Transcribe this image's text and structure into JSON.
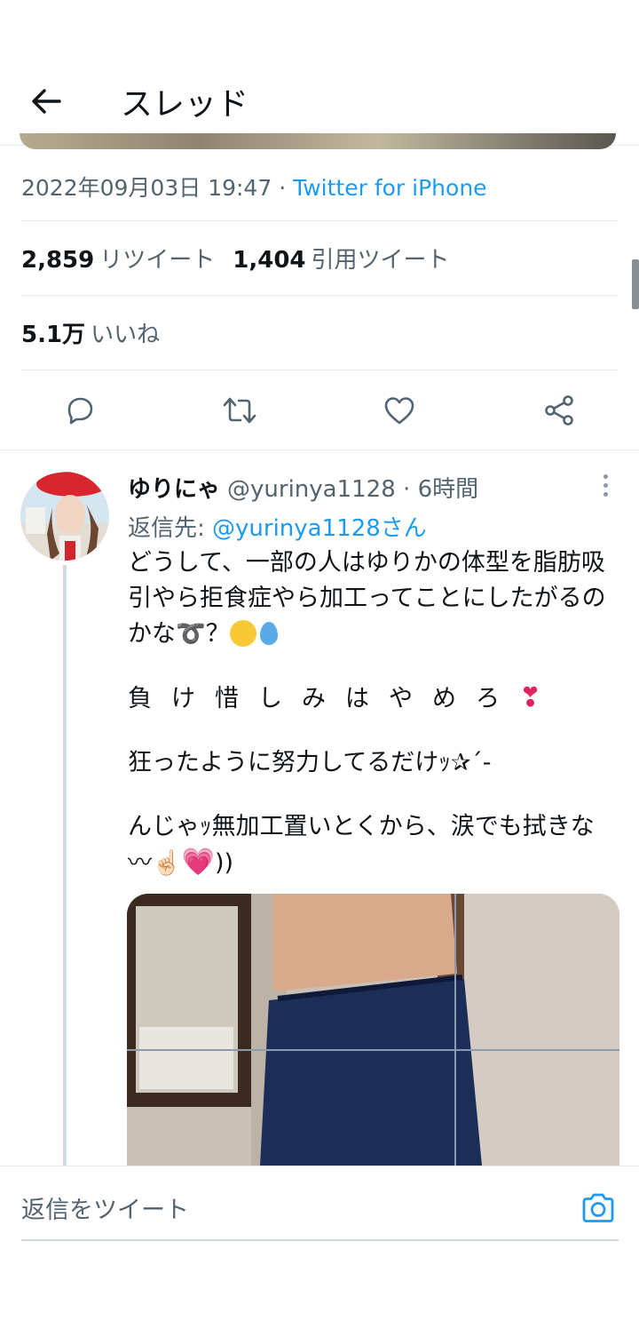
{
  "header": {
    "title": "スレッド",
    "back_icon": "arrow-left-icon"
  },
  "main_tweet": {
    "timestamp": "2022年09月03日 19:47",
    "separator": " · ",
    "client": "Twitter for iPhone",
    "retweets_count": "2,859",
    "retweets_label": "リツイート",
    "quotes_count": "1,404",
    "quotes_label": "引用ツイート",
    "likes_count": "5.1万",
    "likes_label": "いいね",
    "actions": [
      "reply-icon",
      "retweet-icon",
      "like-icon",
      "share-icon"
    ]
  },
  "reply": {
    "name": "ゆりにゃ",
    "handle": "@yurinya1128",
    "time": "6時間",
    "replying_to_label": "返信先: ",
    "replying_to_mention": "@yurinya1128さん",
    "text_line1": "どうして、一部の人はゆりかの体型を脂肪吸引やら拒食症やら加工ってことにしたがるのかな➰？",
    "text_line2": "負けしみはやめろ",
    "text_line2_full": "負け惜しみはやめろ",
    "text_line3": "狂ったように努力してるだけｯ✰´-",
    "text_line4": "んじゃｯ無加工置いとくから、涙でも拭きな〰☝🏻",
    "text_line4_tail": "))"
  },
  "composer": {
    "placeholder": "返信をツイート",
    "camera_icon": "camera-icon"
  },
  "colors": {
    "accent": "#1d9bf0",
    "secondary_text": "#536471",
    "divider": "#e6e9eb"
  }
}
